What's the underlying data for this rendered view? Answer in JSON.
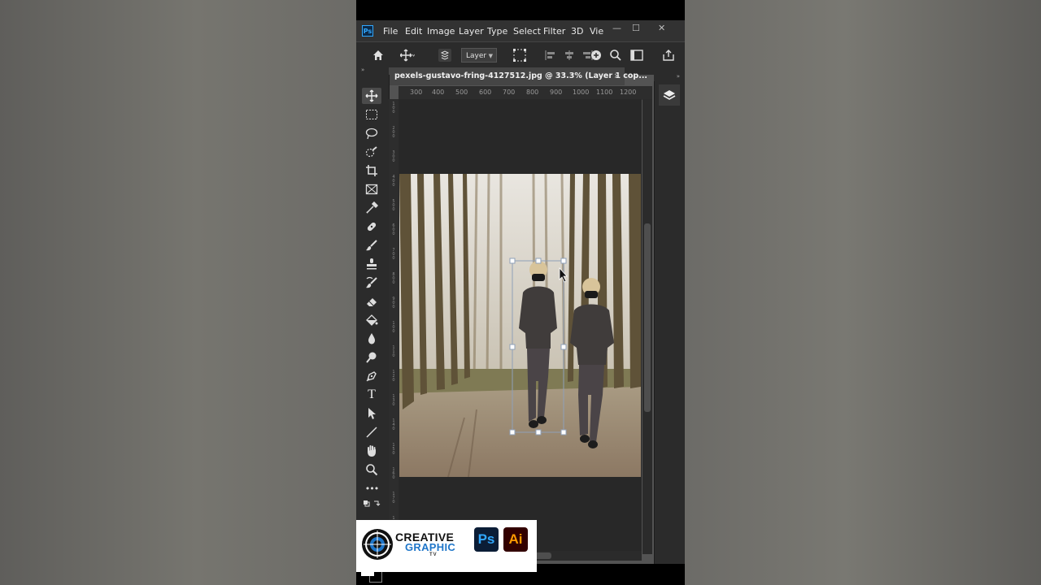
{
  "app": {
    "logo_text": "Ps"
  },
  "menu": {
    "items": [
      "File",
      "Edit",
      "Image",
      "Layer",
      "Type",
      "Select",
      "Filter",
      "3D",
      "Vie"
    ],
    "controls": {
      "minimize": "—",
      "maximize": "☐",
      "close": "✕"
    }
  },
  "options_bar": {
    "auto_select_target": "Layer"
  },
  "document": {
    "tab_title": "pexels-gustavo-fring-4127512.jpg @ 33.3% (Layer 1 cop...",
    "tab_close": "×"
  },
  "ruler": {
    "h_labels": [
      "300",
      "400",
      "500",
      "600",
      "700",
      "800",
      "900",
      "1000",
      "1100",
      "1200"
    ]
  },
  "tools": [
    "move-tool",
    "marquee-tool",
    "lasso-tool",
    "quick-select-tool",
    "crop-tool",
    "frame-tool",
    "eyedropper-tool",
    "healing-brush-tool",
    "brush-tool",
    "clone-stamp-tool",
    "history-brush-tool",
    "eraser-tool",
    "paint-bucket-tool",
    "blur-tool",
    "dodge-tool",
    "pen-tool",
    "type-tool",
    "path-selection-tool",
    "line-tool",
    "hand-tool",
    "zoom-tool",
    "more-tools"
  ],
  "toolbar": {
    "more_label": "•••",
    "type_label": "T"
  },
  "panels": {
    "collapse_left": "«",
    "collapse_right": "»"
  },
  "brand": {
    "line1": "CREATIVE",
    "line2": "GRAPHIC",
    "line3": "TV",
    "badge_ps": "Ps",
    "badge_ai": "Ai",
    "colors": {
      "blue": "#1f76c9",
      "ps_bg": "#0b1d36",
      "ps_fg": "#31a8ff",
      "ai_bg": "#320000",
      "ai_fg": "#ff9a00"
    }
  }
}
